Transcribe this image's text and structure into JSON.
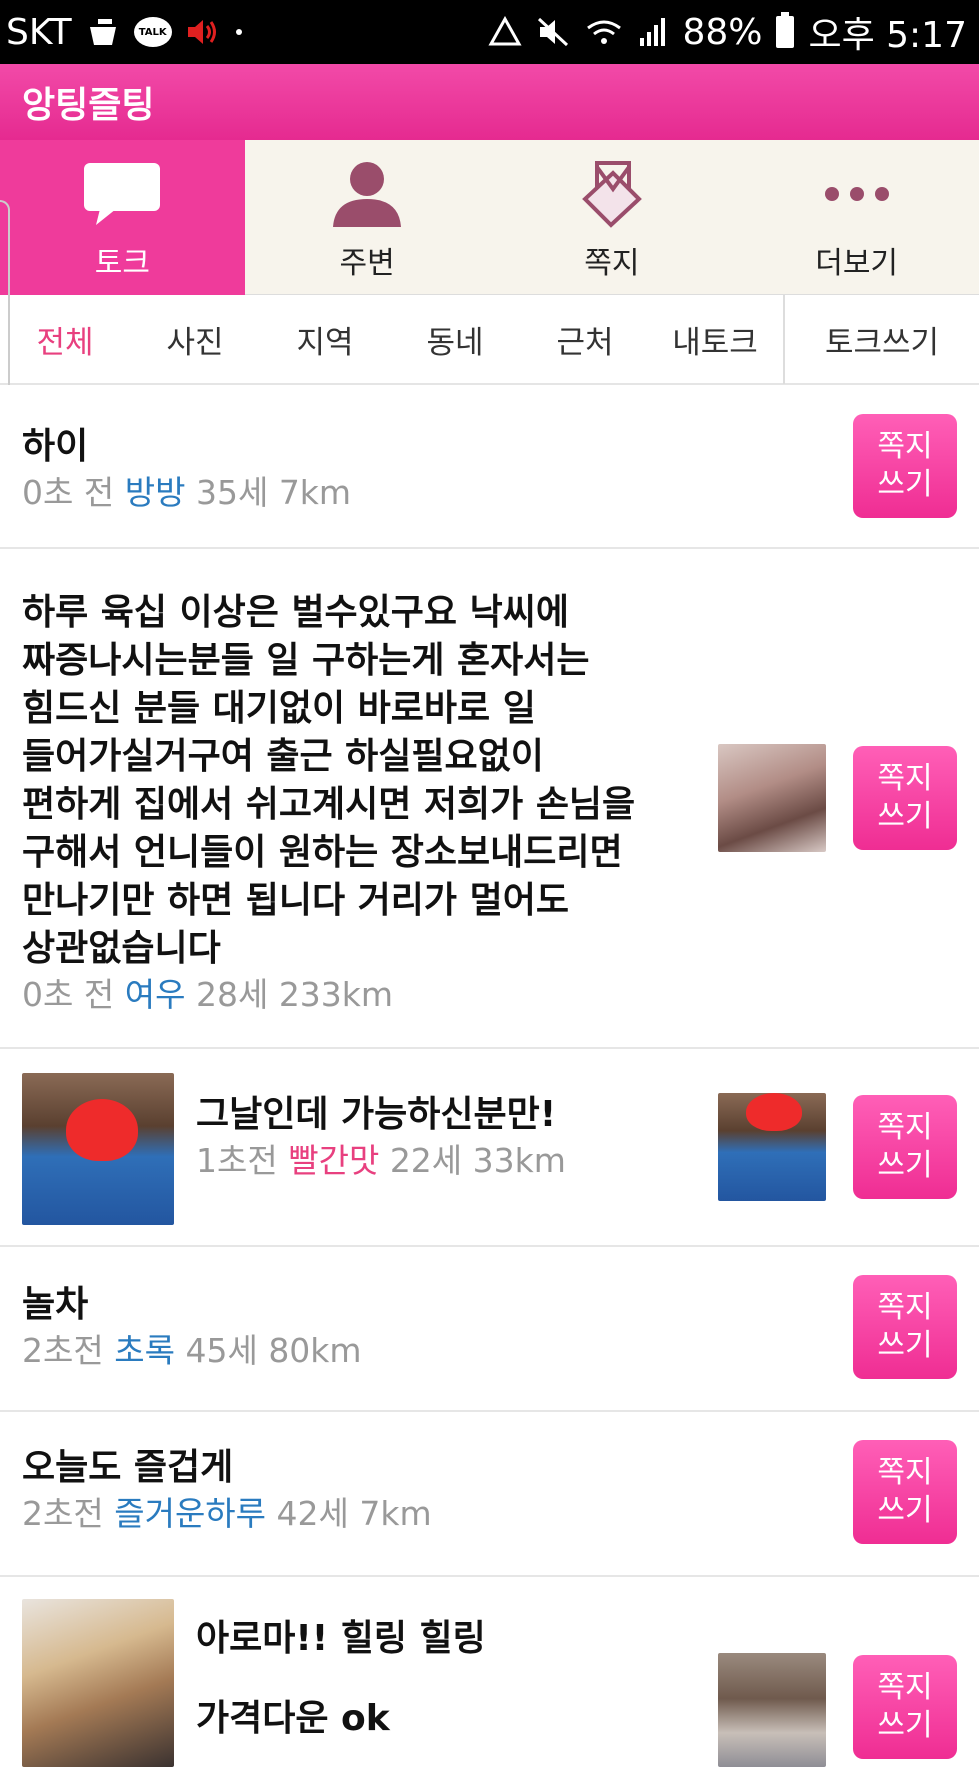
{
  "status_bar": {
    "carrier": "SKT",
    "talk_icon_label": "TALK",
    "battery_percent": "88%",
    "time": "오후 5:17",
    "icons": [
      "trash-icon",
      "kakaotalk-icon",
      "volume-icon",
      "dot-icon",
      "recycle-icon",
      "mute-icon",
      "wifi-icon",
      "signal-icon",
      "battery-icon"
    ]
  },
  "app_bar": {
    "title": "앙팅즐팅"
  },
  "tabs": [
    {
      "label": "토크",
      "icon": "chat-bubble-icon",
      "active": true
    },
    {
      "label": "주변",
      "icon": "person-icon",
      "active": false
    },
    {
      "label": "쪽지",
      "icon": "note-icon",
      "active": false
    },
    {
      "label": "더보기",
      "icon": "more-icon",
      "active": false
    }
  ],
  "sub_tabs": [
    {
      "label": "전체",
      "active": true
    },
    {
      "label": "사진",
      "active": false
    },
    {
      "label": "지역",
      "active": false
    },
    {
      "label": "동네",
      "active": false
    },
    {
      "label": "근처",
      "active": false
    },
    {
      "label": "내토크",
      "active": false
    }
  ],
  "write_talk_label": "토크쓰기",
  "message_button": {
    "line1": "쪽지",
    "line2": "쓰기"
  },
  "posts": [
    {
      "title": "하이",
      "time": "0초 전",
      "nickname": "방방",
      "age": "35세",
      "distance": "7km"
    },
    {
      "title_lines": [
        "하루 육십 이상은 벌수있구요 낙씨에",
        "짜증나시는분들 일 구하는게 혼자서는",
        "힘드신 분들 대기없이 바로바로 일",
        "들어가실거구여 출근 하실필요없이",
        "편하게 집에서 쉬고계시면 저희가 손님을",
        "구해서 언니들이 원하는 장소보내드리면",
        "만나기만 하면 됩니다 거리가 멀어도",
        "상관없습니다"
      ],
      "time": "0초 전",
      "nickname": "여우",
      "age": "28세",
      "distance": "233km"
    },
    {
      "title": "그날인데 가능하신분만!",
      "time": "1초전",
      "nickname": "빨간맛",
      "age": "22세",
      "distance": "33km"
    },
    {
      "title": "놀차",
      "time": "2초전",
      "nickname": "초록",
      "age": "45세",
      "distance": "80km"
    },
    {
      "title": "오늘도 즐겁게",
      "time": "2초전",
      "nickname": "즐거운하루",
      "age": "42세",
      "distance": "7km"
    },
    {
      "title_line1": "아로마!!  힐링 힐링",
      "title_line2": "가격다운 ok"
    }
  ]
}
